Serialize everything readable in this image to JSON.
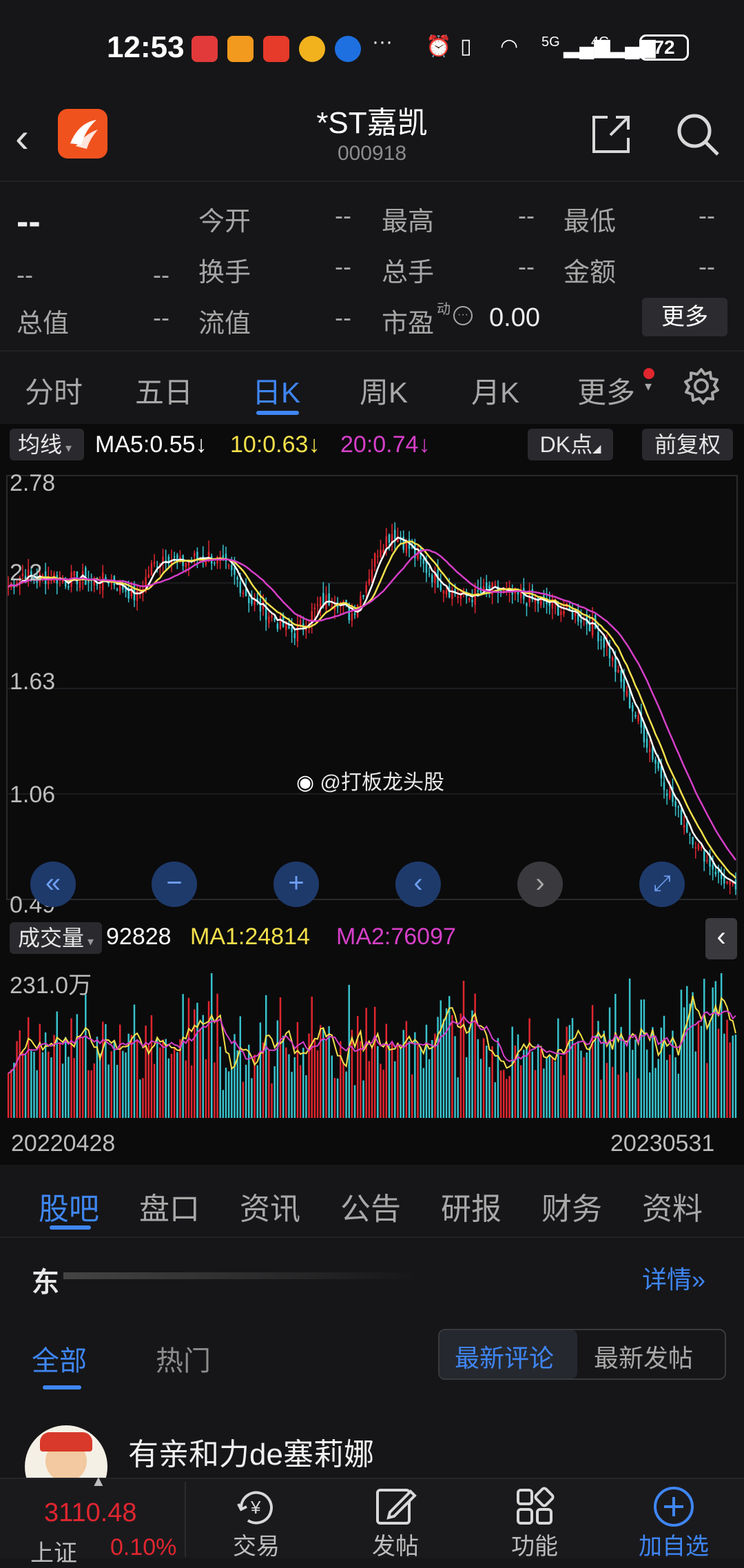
{
  "status_bar": {
    "time": "12:53",
    "signal_1": "5G",
    "signal_2": "4G",
    "battery": "72"
  },
  "header": {
    "title": "*ST嘉凯",
    "code": "000918",
    "back_icon": "chevron-left",
    "share_icon": "share-out",
    "search_icon": "magnifier"
  },
  "quote": {
    "price": "--",
    "change": "--",
    "change_pct": "--",
    "open_label": "今开",
    "open_value": "--",
    "high_label": "最高",
    "high_value": "--",
    "low_label": "最低",
    "low_value": "--",
    "turnover_label": "换手",
    "turnover_value": "--",
    "volume_label": "总手",
    "volume_value": "--",
    "amount_label": "金额",
    "amount_value": "--",
    "mktcap_label": "总值",
    "mktcap_value": "--",
    "float_label": "流值",
    "float_value": "--",
    "pe_label": "市盈",
    "pe_sup": "动",
    "pe_value": "0.00",
    "more_label": "更多"
  },
  "ktabs": [
    "分时",
    "五日",
    "日K",
    "周K",
    "月K",
    "更多"
  ],
  "ktab_active": 2,
  "chart_header": {
    "ma_selector": "均线",
    "ma5": "MA5:0.55",
    "ma10": "10:0.63",
    "ma20": "20:0.74",
    "dk_label": "DK点",
    "adjust_label": "前复权"
  },
  "price_axis": [
    "2.78",
    "2.2",
    "1.63",
    "1.06",
    "0.49"
  ],
  "watermark": "@打板龙头股",
  "volume_header": {
    "selector": "成交量",
    "value": "92828",
    "ma1": "MA1:24814",
    "ma2": "MA2:76097",
    "max_label": "231.0万"
  },
  "dates": {
    "start": "20220428",
    "end": "20230531"
  },
  "colors": {
    "up": "#e0262f",
    "down": "#38c3cd",
    "ma5": "#ffffff",
    "ma10": "#f5e04b",
    "ma20": "#d63fc8",
    "accent": "#3f86f4"
  },
  "chart_data": {
    "type": "candlestick",
    "ylim": [
      0.49,
      2.78
    ],
    "y_ticks": [
      2.78,
      2.2,
      1.63,
      1.06,
      0.49
    ],
    "x_start": "20220428",
    "x_end": "20230531",
    "close_path": [
      2.18,
      2.25,
      2.22,
      2.24,
      2.21,
      2.23,
      2.2,
      2.22,
      2.18,
      2.12,
      2.28,
      2.36,
      2.3,
      2.33,
      2.35,
      2.3,
      2.22,
      2.1,
      2.05,
      1.98,
      1.93,
      2.0,
      2.1,
      2.12,
      2.02,
      2.18,
      2.4,
      2.48,
      2.4,
      2.3,
      2.22,
      2.16,
      2.12,
      2.14,
      2.16,
      2.14,
      2.12,
      2.1,
      2.08,
      2.05,
      2.02,
      1.97,
      1.85,
      1.65,
      1.48,
      1.3,
      1.12,
      0.95,
      0.82,
      0.7,
      0.6,
      0.55
    ],
    "ma5_last": 0.55,
    "ma10_last": 0.63,
    "ma20_last": 0.74,
    "volume_max_label": "231.0万",
    "volume_last": 92828,
    "vol_ma1": 24814,
    "vol_ma2": 76097
  },
  "section_tabs": [
    "股吧",
    "盘口",
    "资讯",
    "公告",
    "研报",
    "财务",
    "资料"
  ],
  "section_active": 0,
  "feed": {
    "notice": "东",
    "detail_label": "详情",
    "filter_all": "全部",
    "filter_hot": "热门",
    "sort_latest_comment": "最新评论",
    "sort_latest_post": "最新发帖",
    "first_user": "有亲和力de塞莉娜"
  },
  "bottom_nav": {
    "index_value": "3110.48",
    "index_name": "上证",
    "index_pct": "0.10%",
    "trade": "交易",
    "post": "发帖",
    "func": "功能",
    "add": "加自选"
  }
}
